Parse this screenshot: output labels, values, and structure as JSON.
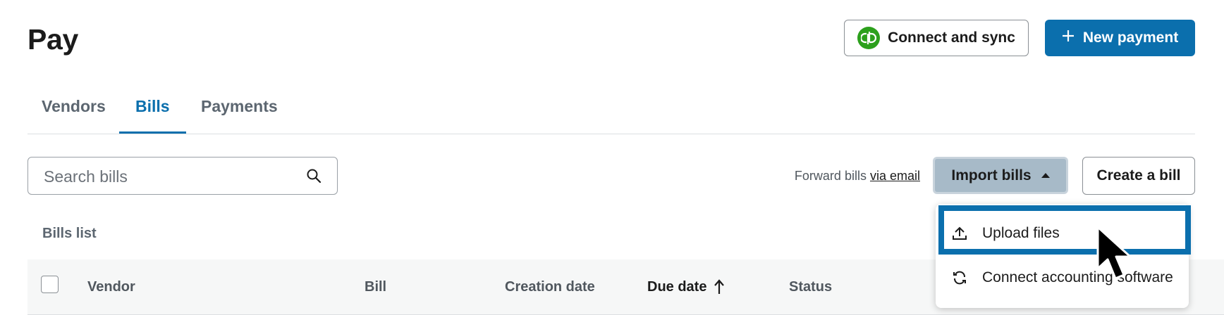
{
  "header": {
    "title": "Pay",
    "connect_label": "Connect and sync",
    "new_payment_label": "New payment"
  },
  "tabs": [
    {
      "label": "Vendors",
      "active": false
    },
    {
      "label": "Bills",
      "active": true
    },
    {
      "label": "Payments",
      "active": false
    }
  ],
  "toolbar": {
    "search_placeholder": "Search bills",
    "search_value": "",
    "forward_text": "Forward bills",
    "forward_link": "via email",
    "import_label": "Import bills",
    "create_label": "Create a bill"
  },
  "import_menu": {
    "items": [
      {
        "label": "Upload files",
        "icon": "upload-icon"
      },
      {
        "label": "Connect accounting software",
        "icon": "sync-icon"
      }
    ]
  },
  "list": {
    "label": "Bills list",
    "columns": [
      "Vendor",
      "Bill",
      "Creation date",
      "Due date",
      "Status"
    ],
    "sorted_column": "Due date",
    "sort_direction": "ascending"
  },
  "colors": {
    "accent": "#0b6fad",
    "quickbooks_green": "#2ca01c",
    "import_active_bg": "#a7bac8"
  }
}
